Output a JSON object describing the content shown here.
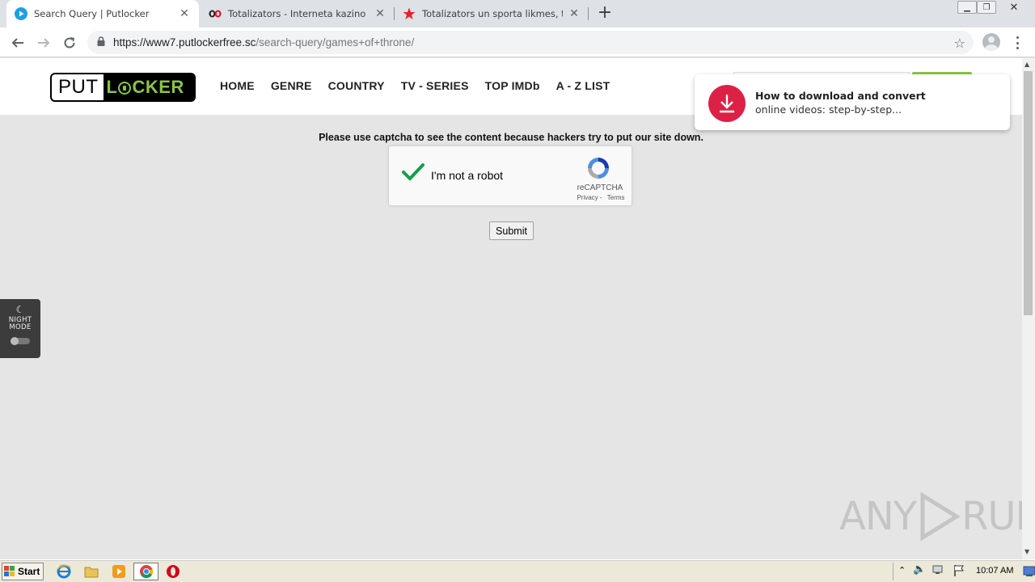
{
  "browser": {
    "tabs": [
      {
        "title": "Search Query | Putlocker",
        "active": true,
        "icon": "putlocker-play-icon"
      },
      {
        "title": "Totalizators - Interneta kazino spēles",
        "active": false,
        "icon": "totalizators-icon"
      },
      {
        "title": "Totalizators un sporta likmes, tiešraide",
        "active": false,
        "icon": "red-star-icon"
      }
    ],
    "url_host": "https://www7.putlockerfree.sc",
    "url_path": "/search-query/games+of+throne/"
  },
  "site": {
    "logo_put": "PUT",
    "logo_locker": "LCKER",
    "nav": [
      "HOME",
      "GENRE",
      "COUNTRY",
      "TV - SERIES",
      "TOP IMDb",
      "A - Z LIST"
    ]
  },
  "notification": {
    "title": "How to download and convert",
    "text": "online videos: step-by-step..."
  },
  "captcha": {
    "message": "Please use captcha to see the content because hackers try to put our site down.",
    "label": "I'm not a robot",
    "brand": "reCAPTCHA",
    "privacy": "Privacy",
    "terms": "Terms",
    "submit": "Submit"
  },
  "night_mode": {
    "label_line1": "NIGHT",
    "label_line2": "MODE",
    "enabled": false
  },
  "watermark": {
    "left": "ANY",
    "right": "RUN"
  },
  "taskbar": {
    "start": "Start",
    "clock": "10:07 AM"
  },
  "colors": {
    "accent_green": "#8bc34a",
    "notify_red": "#dc2146",
    "page_bg": "#e5e5e5"
  }
}
